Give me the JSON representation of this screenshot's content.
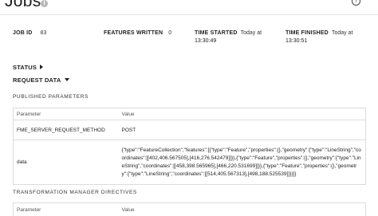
{
  "header": {
    "title": "Jobs",
    "info_glyph": "i",
    "help_glyph": "?"
  },
  "summary": {
    "job_id_label": "JOB ID",
    "job_id_value": "83",
    "features_label": "FEATURES WRITTEN",
    "features_value": "0",
    "started_label": "TIME STARTED",
    "started_line1": "Today at",
    "started_line2": "13:30:49",
    "finished_label": "TIME FINISHED",
    "finished_line1": "Today at",
    "finished_line2": "13:30:51"
  },
  "sections": {
    "status_label": "STATUS",
    "request_data_label": "REQUEST DATA"
  },
  "published_parameters": {
    "heading": "PUBLISHED PARAMETERS",
    "columns": [
      "Parameter",
      "Value"
    ],
    "rows": [
      {
        "parameter": "FME_SERVER_REQUEST_METHOD",
        "value": "POST"
      },
      {
        "parameter": "data",
        "value": "{\"type\":\"FeatureCollection\",\"features\":[{\"type\":\"Feature\",\"properties\":{},\"geometry\":{\"type\":\"LineString\",\"coordinates\":[[402,406.567505],[416,276.542479]]}},{\"type\":\"Feature\",\"properties\":{},\"geometry\":{\"type\":\"LineString\",\"coordinates\":[[458,398.565965],[466,220.531699]]}},{\"type\":\"Feature\",\"properties\":{},\"geometry\":{\"type\":\"LineString\",\"coordinates\":[[514,405.567313],[498,188.525539]]}}]}"
      }
    ]
  },
  "transformation_directives": {
    "heading": "TRANSFORMATION MANAGER DIRECTIVES",
    "columns": [
      "Parameter",
      "Value"
    ]
  },
  "icons": {
    "info": "info-icon",
    "help": "help-icon",
    "status_toggle": "caret-right-icon",
    "request_toggle": "caret-down-icon"
  }
}
